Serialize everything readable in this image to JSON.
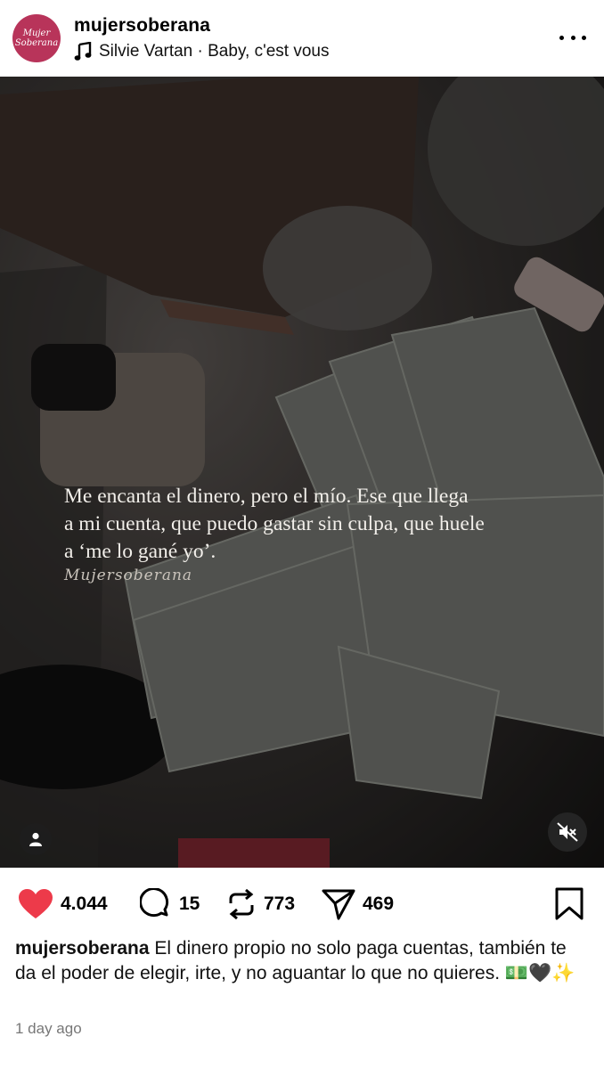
{
  "header": {
    "avatar_text_line1": "Mujer",
    "avatar_text_line2": "Soberana",
    "username": "mujersoberana",
    "music": "Silvie Vartan · Baby, c'est vous"
  },
  "media": {
    "overlay_lines": [
      "Me encanta el dinero, pero el mío. Ese que llega",
      "a mi cuenta, que puedo gastar sin culpa, que huele",
      "a ‘me lo gané yo’."
    ],
    "watermark": "Mujersoberana"
  },
  "actions": {
    "likes": "4.044",
    "comments": "15",
    "reposts": "773",
    "shares": "469",
    "liked_color": "#ed3a4a"
  },
  "caption": {
    "username": "mujersoberana",
    "text": "El dinero propio no solo paga cuentas, también te da el poder de elegir, irte, y no aguantar lo que no quieres. 💵🖤✨"
  },
  "timestamp": "1 day ago"
}
